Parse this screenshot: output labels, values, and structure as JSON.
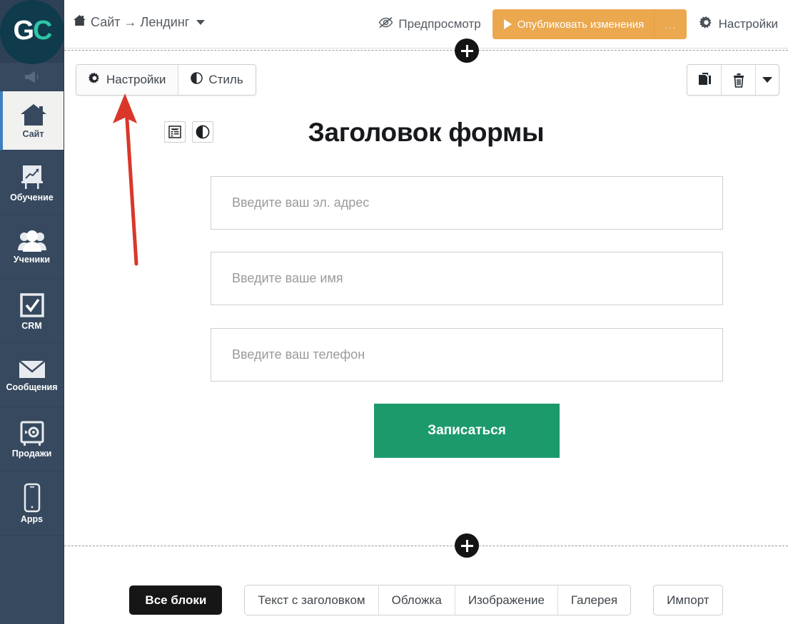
{
  "sidebar": {
    "logo": {
      "text_g": "G",
      "text_c": "C",
      "name": "gc-logo"
    },
    "items": [
      {
        "label": "",
        "icon": "megaphone-icon",
        "name": "announcements"
      },
      {
        "label": "Сайт",
        "icon": "home-icon",
        "name": "site",
        "active": true
      },
      {
        "label": "Обучение",
        "icon": "easel-chart-icon",
        "name": "training"
      },
      {
        "label": "Ученики",
        "icon": "users-icon",
        "name": "students"
      },
      {
        "label": "CRM",
        "icon": "checkbox-icon",
        "name": "crm"
      },
      {
        "label": "Сообщения",
        "icon": "envelope-icon",
        "name": "messages"
      },
      {
        "label": "Продажи",
        "icon": "safe-icon",
        "name": "sales"
      },
      {
        "label": "Apps",
        "icon": "phone-icon",
        "name": "apps"
      }
    ]
  },
  "header": {
    "breadcrumb": {
      "home_icon": "home-icon",
      "text": "Сайт → Лендинг",
      "caret_icon": "caret-down-icon"
    },
    "preview": {
      "label": "Предпросмотр",
      "icon": "eye-slash-icon"
    },
    "publish": {
      "label": "Опубликовать изменения",
      "icon": "play-icon",
      "more_label": "...",
      "color": "#eba84e"
    },
    "settings": {
      "label": "Настройки",
      "icon": "gear-icon"
    }
  },
  "block_toolbar": {
    "tabs": [
      {
        "label": "Настройки",
        "icon": "gear-icon",
        "name": "settings"
      },
      {
        "label": "Стиль",
        "icon": "contrast-icon",
        "name": "style"
      }
    ],
    "actions": [
      {
        "icon": "copy-icon",
        "name": "duplicate-block"
      },
      {
        "icon": "trash-icon",
        "name": "delete-block"
      },
      {
        "icon": "chevron-down-icon",
        "name": "more-options"
      }
    ]
  },
  "form_block": {
    "mini_icons": [
      {
        "icon": "form-settings-icon",
        "name": "form-settings"
      },
      {
        "icon": "contrast-icon",
        "name": "form-style"
      }
    ],
    "title": "Заголовок формы",
    "fields": [
      {
        "placeholder": "Введите ваш эл. адрес",
        "name": "email-field"
      },
      {
        "placeholder": "Введите ваше имя",
        "name": "name-field"
      },
      {
        "placeholder": "Введите ваш телефон",
        "name": "phone-field"
      }
    ],
    "submit": {
      "label": "Записаться",
      "color": "#1d9a6c"
    }
  },
  "add_block_buttons": [
    {
      "icon": "plus-icon",
      "name": "add-block-top"
    },
    {
      "icon": "plus-icon",
      "name": "add-block-bottom"
    }
  ],
  "palette": {
    "all_blocks_label": "Все блоки",
    "groups": [
      {
        "items": [
          "Текст с заголовком",
          "Обложка",
          "Изображение",
          "Галерея"
        ]
      },
      {
        "items": [
          "Импорт"
        ]
      }
    ]
  },
  "annotation": {
    "arrow_color": "#d9372a",
    "name": "red-arrow-pointing-to-settings-tab"
  }
}
